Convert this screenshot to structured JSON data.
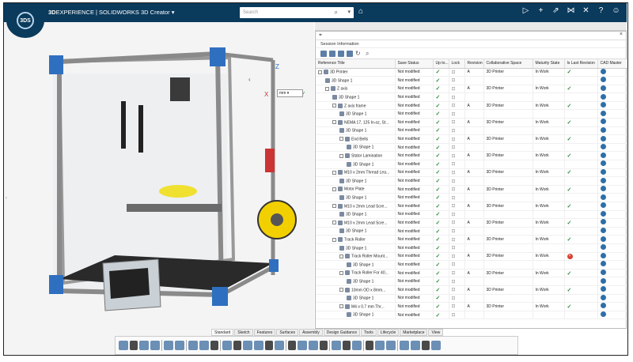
{
  "header": {
    "brand_bold": "3D",
    "brand_rest": "EXPERIENCE | SOLIDWORKS  3D Creator",
    "logo_text": "3DS",
    "search_placeholder": "Search"
  },
  "viewport": {
    "axes": {
      "x": "X",
      "y": "Y",
      "z": "Z"
    },
    "units_value": "mm"
  },
  "panel": {
    "section": "Session Information",
    "columns": [
      "Reference Title",
      "Save Status",
      "Up to...",
      "Lock",
      "Revision",
      "Collaborative Space",
      "Maturity State",
      "Is Last Revision",
      "CAD Master"
    ],
    "rows": [
      {
        "indent": 0,
        "exp": true,
        "title": "3D Printer",
        "status": "Not modified",
        "up": true,
        "lock": true,
        "rev": "A",
        "space": "3D Printer",
        "state": "In Work",
        "last": "ok",
        "cad": true
      },
      {
        "indent": 1,
        "exp": false,
        "title": "3D Shape 1",
        "status": "Not modified",
        "up": true,
        "lock": true,
        "rev": "",
        "space": "",
        "state": "",
        "last": "",
        "cad": true
      },
      {
        "indent": 1,
        "exp": true,
        "title": "Z axis",
        "status": "Not modified",
        "up": true,
        "lock": true,
        "rev": "A",
        "space": "3D Printer",
        "state": "In Work",
        "last": "ok",
        "cad": true
      },
      {
        "indent": 2,
        "exp": false,
        "title": "3D Shape 1",
        "status": "Not modified",
        "up": true,
        "lock": true,
        "rev": "",
        "space": "",
        "state": "",
        "last": "",
        "cad": true
      },
      {
        "indent": 2,
        "exp": true,
        "title": "Z axis frame",
        "status": "Not modified",
        "up": true,
        "lock": true,
        "rev": "A",
        "space": "3D Printer",
        "state": "In Work",
        "last": "ok",
        "cad": true
      },
      {
        "indent": 3,
        "exp": false,
        "title": "3D Shape 1",
        "status": "Not modified",
        "up": true,
        "lock": true,
        "rev": "",
        "space": "",
        "state": "",
        "last": "",
        "cad": true
      },
      {
        "indent": 2,
        "exp": true,
        "title": "NEMA 17, 125 In-oz, St...",
        "status": "Not modified",
        "up": true,
        "lock": true,
        "rev": "A",
        "space": "3D Printer",
        "state": "In Work",
        "last": "ok",
        "cad": true
      },
      {
        "indent": 3,
        "exp": false,
        "title": "3D Shape 1",
        "status": "Not modified",
        "up": true,
        "lock": true,
        "rev": "",
        "space": "",
        "state": "",
        "last": "",
        "cad": true
      },
      {
        "indent": 3,
        "exp": true,
        "title": "End Bells",
        "status": "Not modified",
        "up": true,
        "lock": true,
        "rev": "A",
        "space": "3D Printer",
        "state": "In Work",
        "last": "ok",
        "cad": true
      },
      {
        "indent": 4,
        "exp": false,
        "title": "3D Shape 1",
        "status": "Not modified",
        "up": true,
        "lock": true,
        "rev": "",
        "space": "",
        "state": "",
        "last": "",
        "cad": true
      },
      {
        "indent": 3,
        "exp": true,
        "title": "Stator Lamination",
        "status": "Not modified",
        "up": true,
        "lock": true,
        "rev": "A",
        "space": "3D Printer",
        "state": "In Work",
        "last": "ok",
        "cad": true
      },
      {
        "indent": 4,
        "exp": false,
        "title": "3D Shape 1",
        "status": "Not modified",
        "up": true,
        "lock": true,
        "rev": "",
        "space": "",
        "state": "",
        "last": "",
        "cad": true
      },
      {
        "indent": 2,
        "exp": true,
        "title": "M10 x 2mm Thread Lea...",
        "status": "Not modified",
        "up": true,
        "lock": true,
        "rev": "A",
        "space": "3D Printer",
        "state": "In Work",
        "last": "ok",
        "cad": true
      },
      {
        "indent": 3,
        "exp": false,
        "title": "3D Shape 1",
        "status": "Not modified",
        "up": true,
        "lock": true,
        "rev": "",
        "space": "",
        "state": "",
        "last": "",
        "cad": true
      },
      {
        "indent": 2,
        "exp": true,
        "title": "Motor Plate",
        "status": "Not modified",
        "up": true,
        "lock": true,
        "rev": "A",
        "space": "3D Printer",
        "state": "In Work",
        "last": "ok",
        "cad": true
      },
      {
        "indent": 3,
        "exp": false,
        "title": "3D Shape 1",
        "status": "Not modified",
        "up": true,
        "lock": true,
        "rev": "",
        "space": "",
        "state": "",
        "last": "",
        "cad": true
      },
      {
        "indent": 2,
        "exp": true,
        "title": "M10 x 2mm Lead Scre...",
        "status": "Not modified",
        "up": true,
        "lock": true,
        "rev": "A",
        "space": "3D Printer",
        "state": "In Work",
        "last": "ok",
        "cad": true
      },
      {
        "indent": 3,
        "exp": false,
        "title": "3D Shape 1",
        "status": "Not modified",
        "up": true,
        "lock": true,
        "rev": "",
        "space": "",
        "state": "",
        "last": "",
        "cad": true
      },
      {
        "indent": 2,
        "exp": true,
        "title": "M10 x 2mm Lead Scre...",
        "status": "Not modified",
        "up": true,
        "lock": true,
        "rev": "A",
        "space": "3D Printer",
        "state": "In Work",
        "last": "ok",
        "cad": true
      },
      {
        "indent": 3,
        "exp": false,
        "title": "3D Shape 1",
        "status": "Not modified",
        "up": true,
        "lock": true,
        "rev": "",
        "space": "",
        "state": "",
        "last": "",
        "cad": true
      },
      {
        "indent": 2,
        "exp": true,
        "title": "Track Roller",
        "status": "Not modified",
        "up": true,
        "lock": true,
        "rev": "A",
        "space": "3D Printer",
        "state": "In Work",
        "last": "ok",
        "cad": true
      },
      {
        "indent": 3,
        "exp": false,
        "title": "3D Shape 1",
        "status": "Not modified",
        "up": true,
        "lock": true,
        "rev": "",
        "space": "",
        "state": "",
        "last": "",
        "cad": true
      },
      {
        "indent": 3,
        "exp": true,
        "title": "Track Roller Mount...",
        "status": "Not modified",
        "up": true,
        "lock": true,
        "rev": "A",
        "space": "3D Printer",
        "state": "In Work",
        "last": "err",
        "cad": true
      },
      {
        "indent": 4,
        "exp": false,
        "title": "3D Shape 1",
        "status": "Not modified",
        "up": true,
        "lock": true,
        "rev": "",
        "space": "",
        "state": "",
        "last": "",
        "cad": true
      },
      {
        "indent": 3,
        "exp": true,
        "title": "Track Roller For 40...",
        "status": "Not modified",
        "up": true,
        "lock": true,
        "rev": "A",
        "space": "3D Printer",
        "state": "In Work",
        "last": "ok",
        "cad": true
      },
      {
        "indent": 4,
        "exp": false,
        "title": "3D Shape 1",
        "status": "Not modified",
        "up": true,
        "lock": true,
        "rev": "",
        "space": "",
        "state": "",
        "last": "",
        "cad": true
      },
      {
        "indent": 3,
        "exp": true,
        "title": "10mm OD x 8mm...",
        "status": "Not modified",
        "up": true,
        "lock": true,
        "rev": "A",
        "space": "3D Printer",
        "state": "In Work",
        "last": "ok",
        "cad": true
      },
      {
        "indent": 4,
        "exp": false,
        "title": "3D Shape 1",
        "status": "Not modified",
        "up": true,
        "lock": true,
        "rev": "",
        "space": "",
        "state": "",
        "last": "",
        "cad": true
      },
      {
        "indent": 3,
        "exp": true,
        "title": "M4 x 0.7 mm Thr...",
        "status": "Not modified",
        "up": true,
        "lock": true,
        "rev": "A",
        "space": "3D Printer",
        "state": "In Work",
        "last": "ok",
        "cad": true
      },
      {
        "indent": 4,
        "exp": false,
        "title": "3D Shape 1",
        "status": "Not modified",
        "up": true,
        "lock": true,
        "rev": "",
        "space": "",
        "state": "",
        "last": "",
        "cad": true
      }
    ]
  },
  "tabs": [
    "Standard",
    "Sketch",
    "Features",
    "Surfaces",
    "Assembly",
    "Design Guidance",
    "Tools",
    "Lifecycle",
    "Marketplace",
    "View"
  ],
  "active_tab": "Standard"
}
